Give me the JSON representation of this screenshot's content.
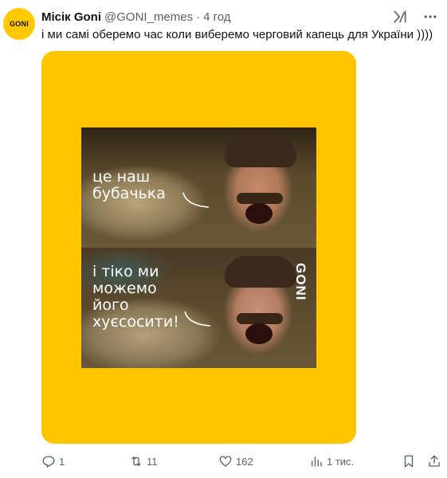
{
  "avatar": {
    "logo_text": "GONI"
  },
  "author": {
    "display_name": "Місік Goni",
    "handle": "@GONI_memes",
    "separator": "·",
    "time": "4 год"
  },
  "header_icons": [
    "grok-icon",
    "more-icon"
  ],
  "tweet_text": "і ми самі оберемо час коли виберемо черговий капець для України ))))",
  "media": {
    "background_color": "#ffc600",
    "caption_top": [
      "це наш",
      "бубачька"
    ],
    "caption_bottom": [
      "і тіко ми",
      "можемо",
      "його",
      "хуєсосити!"
    ],
    "watermark": "GONI"
  },
  "actions": {
    "replies": "1",
    "reposts": "11",
    "likes": "162",
    "views": "1 тис."
  }
}
